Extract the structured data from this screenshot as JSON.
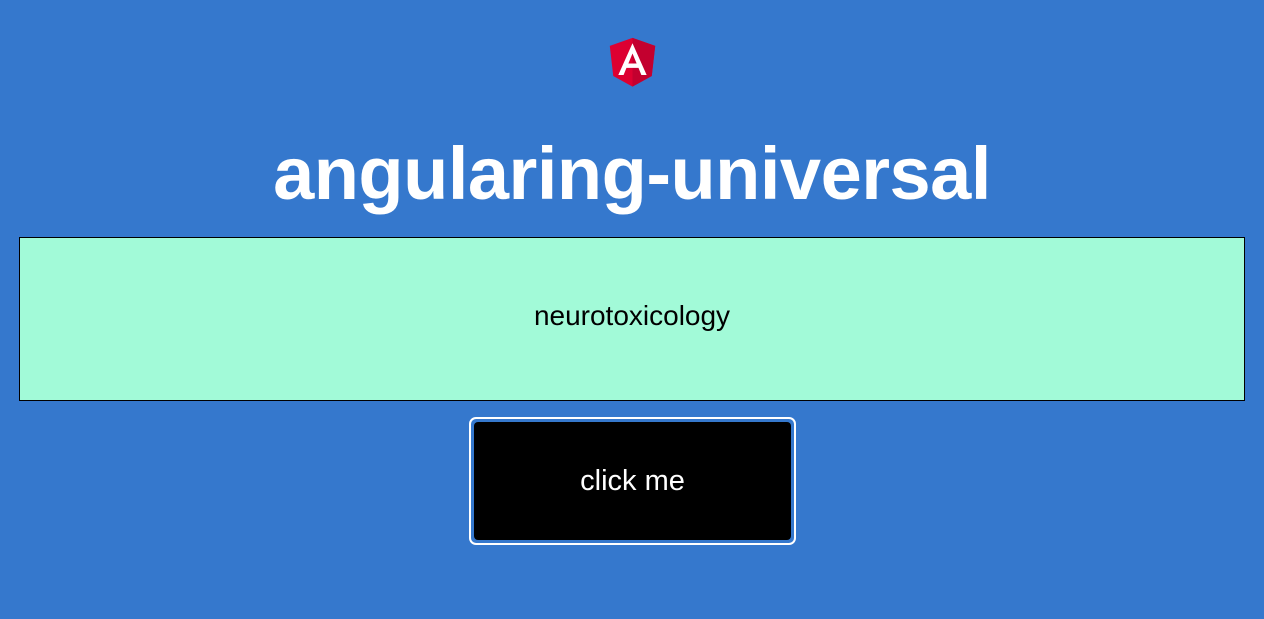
{
  "app": {
    "logo_icon": "angular-logo-icon",
    "title": "angularing-universal"
  },
  "main": {
    "word": "neurotoxicology",
    "button_label": "click me"
  },
  "colors": {
    "background": "#3578cd",
    "word_box": "#a2fad8",
    "button": "#000000",
    "logo_red": "#dd0031",
    "logo_dark_red": "#c3002f"
  }
}
